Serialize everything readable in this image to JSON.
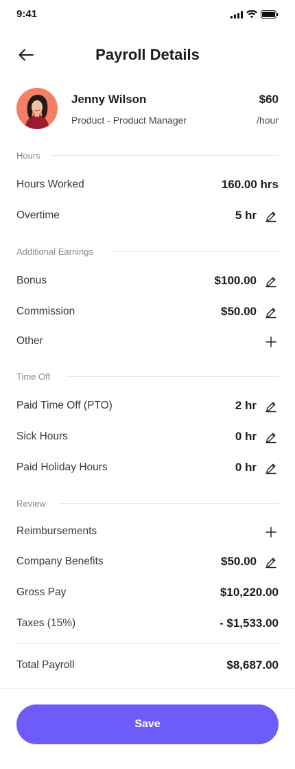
{
  "status_bar": {
    "time": "9:41"
  },
  "header": {
    "title": "Payroll Details"
  },
  "employee": {
    "name": "Jenny Wilson",
    "role": "Product - Product Manager",
    "rate": "$60",
    "rate_unit": "/hour"
  },
  "sections": {
    "hours": {
      "label": "Hours",
      "hours_worked": {
        "label": "Hours Worked",
        "value": "160.00 hrs"
      },
      "overtime": {
        "label": "Overtime",
        "value": "5 hr"
      }
    },
    "additional_earnings": {
      "label": "Additional Earnings",
      "bonus": {
        "label": "Bonus",
        "value": "$100.00"
      },
      "commission": {
        "label": "Commission",
        "value": "$50.00"
      },
      "other": {
        "label": "Other"
      }
    },
    "time_off": {
      "label": "Time Off",
      "pto": {
        "label": "Paid Time Off (PTO)",
        "value": "2 hr"
      },
      "sick": {
        "label": "Sick Hours",
        "value": "0 hr"
      },
      "holiday": {
        "label": "Paid Holiday Hours",
        "value": "0 hr"
      }
    },
    "review": {
      "label": "Review",
      "reimbursements": {
        "label": "Reimbursements"
      },
      "benefits": {
        "label": "Company Benefits",
        "value": "$50.00"
      },
      "gross": {
        "label": "Gross Pay",
        "value": "$10,220.00"
      },
      "taxes": {
        "label": "Taxes (15%)",
        "value": "- $1,533.00"
      }
    }
  },
  "total": {
    "label": "Total Payroll",
    "value": "$8,687.00"
  },
  "actions": {
    "save_label": "Save"
  },
  "colors": {
    "primary": "#6d5cfa",
    "avatar_bg": "#f27f66"
  },
  "icons": {
    "back": "arrow-left-icon",
    "edit": "pencil-icon",
    "add": "plus-icon"
  }
}
